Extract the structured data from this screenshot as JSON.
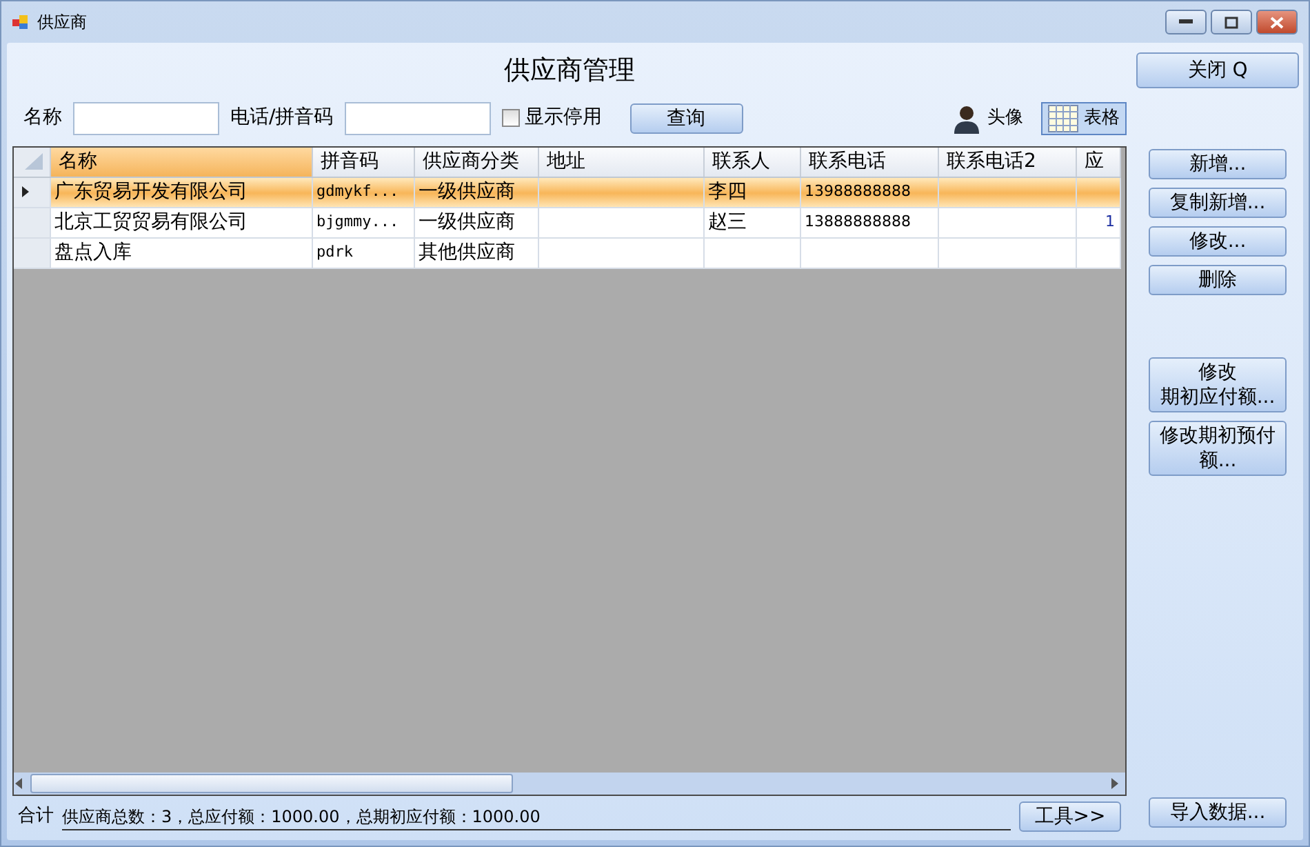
{
  "window": {
    "title": "供应商"
  },
  "heading": "供应商管理",
  "search": {
    "fields": [
      {
        "label": "名称"
      },
      {
        "label": "电话/拼音码"
      }
    ],
    "checkbox": {
      "label": "显示停用",
      "checked": false
    },
    "query_button": "查询"
  },
  "view_toggle": [
    {
      "label": "头像",
      "kind": "avatar",
      "selected": false
    },
    {
      "label": "表格",
      "kind": "grid",
      "selected": true
    }
  ],
  "close_button": "关闭 Q",
  "table": {
    "columns": [
      "名称",
      "拼音码",
      "供应商分类",
      "地址",
      "联系人",
      "联系电话",
      "联系电话2",
      "应"
    ],
    "rows": [
      {
        "selected": true,
        "cells": [
          "广东贸易开发有限公司",
          "gdmykf...",
          "一级供应商",
          "",
          "李四",
          "13988888888",
          "",
          ""
        ]
      },
      {
        "selected": false,
        "cells": [
          "北京工贸贸易有限公司",
          "bjgmmy...",
          "一级供应商",
          "",
          "赵三",
          "13888888888",
          "",
          "1"
        ]
      },
      {
        "selected": false,
        "cells": [
          "盘点入库",
          "pdrk",
          "其他供应商",
          "",
          "",
          "",
          "",
          ""
        ]
      }
    ]
  },
  "side_groups": [
    [
      [
        "新增..."
      ],
      [
        "复制新增..."
      ],
      [
        "修改..."
      ],
      [
        "删除"
      ]
    ],
    [
      [
        "修改",
        "期初应付额..."
      ],
      [
        "修改期初预付额..."
      ]
    ],
    [
      [
        "导入数据..."
      ]
    ]
  ],
  "footer": {
    "label": "合计",
    "summary": "供应商总数：3，总应付额：1000.00，总期初应付额：1000.00",
    "tools_button": "工具>>"
  }
}
